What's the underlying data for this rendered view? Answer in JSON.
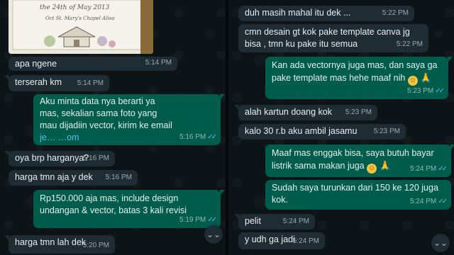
{
  "left": {
    "image": {
      "script_lines": [
        "the 24th of May 2013",
        "Oct St. Mary's Chapel Aliso"
      ]
    },
    "messages": [
      {
        "id": "l1",
        "text": "apa ngene",
        "time": "5:14 PM"
      },
      {
        "id": "l2",
        "text": "terserah km",
        "time": "5:14 PM"
      },
      {
        "id": "l3",
        "line1": "Aku minta data nya berarti ya",
        "line2": "mas, sekalian sama foto yang",
        "line3": "mau dijadiin vector, kirim ke email",
        "email": "je… …om",
        "time": "5:16 PM"
      },
      {
        "id": "l4",
        "text": "oya brp harganya?",
        "time": "5:16 PM"
      },
      {
        "id": "l5",
        "text": "harga tmn aja y dek",
        "time": "5:16 PM"
      },
      {
        "id": "l6",
        "line1": "Rp150.000 aja mas, include design",
        "line2": "undangan & vector, batas 3 kali revisi",
        "time": "5:19 PM"
      },
      {
        "id": "l7",
        "text": "harga tmn lah dek",
        "time": "5:20 PM"
      }
    ],
    "scroll_icon": "⌄⌄"
  },
  "right": {
    "messages": [
      {
        "id": "r1",
        "text": "duh masih mahal itu dek ...",
        "time": "5:22 PM"
      },
      {
        "id": "r2",
        "line1": "cmn desain gt kok pake template canva jg",
        "line2": "bisa , tmn ku pake itu semua",
        "time": "5:22 PM"
      },
      {
        "id": "r3",
        "line1": "Kan ada vectornya juga mas, dan saya ga",
        "line2": "pake template mas hehe maaf nih",
        "time": "5:23 PM"
      },
      {
        "id": "r4",
        "text": "alah kartun doang kok",
        "time": "5:23 PM"
      },
      {
        "id": "r5",
        "text": "kalo 30 r.b aku ambil jasamu",
        "time": "5:23 PM"
      },
      {
        "id": "r6",
        "line1": "Maaf mas enggak bisa, saya butuh bayar",
        "line2": "listrik sama makan juga",
        "time": "5:24 PM"
      },
      {
        "id": "r7",
        "line1": "Sudah saya turunkan dari 150 ke 120 juga",
        "line2": "kok.",
        "time": "5:24 PM"
      },
      {
        "id": "r8",
        "text": "pelit",
        "time": "5:24 PM"
      },
      {
        "id": "r9",
        "text": "y udh ga jadi",
        "time": "5:24 PM"
      }
    ],
    "scroll_icon": "⌄⌄"
  },
  "colors": {
    "incoming": "#1f2c33",
    "outgoing": "#005c4b",
    "read_ticks": "#53bdeb"
  },
  "icons": {
    "read": "✓✓",
    "smile": "☺",
    "pray": "🙏"
  }
}
